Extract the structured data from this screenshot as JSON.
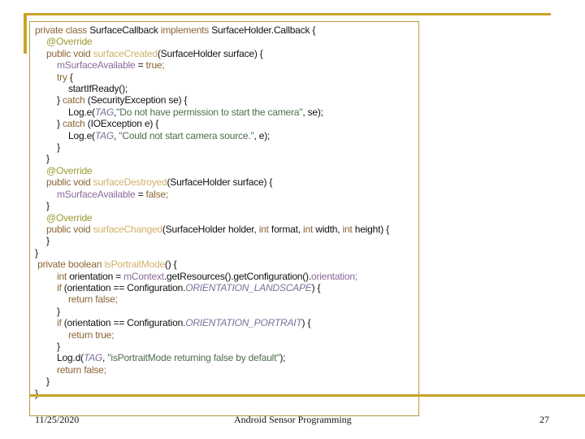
{
  "code_lines": [
    {
      "indent": 0,
      "segs": [
        [
          "private class ",
          "kw"
        ],
        [
          "SurfaceCallback ",
          "plain"
        ],
        [
          "implements ",
          "kw"
        ],
        [
          "SurfaceHolder.Callback {",
          "plain"
        ]
      ]
    },
    {
      "indent": 1,
      "segs": [
        [
          "@Override",
          "ann"
        ]
      ]
    },
    {
      "indent": 1,
      "segs": [
        [
          "public void ",
          "kw"
        ],
        [
          "surfaceCreated",
          "mth"
        ],
        [
          "(SurfaceHolder surface) {",
          "plain"
        ]
      ]
    },
    {
      "indent": 2,
      "segs": [
        [
          "mSurfaceAvailable",
          "fld"
        ],
        [
          " = ",
          "plain"
        ],
        [
          "true;",
          "kw"
        ]
      ]
    },
    {
      "indent": 2,
      "segs": [
        [
          "try",
          "kw"
        ],
        [
          " {",
          "plain"
        ]
      ]
    },
    {
      "indent": 3,
      "segs": [
        [
          "startIfReady();",
          "plain"
        ]
      ]
    },
    {
      "indent": 2,
      "segs": [
        [
          "} ",
          "plain"
        ],
        [
          "catch",
          "kw"
        ],
        [
          " (SecurityException se) {",
          "plain"
        ]
      ]
    },
    {
      "indent": 3,
      "segs": [
        [
          "Log.",
          "plain"
        ],
        [
          "e",
          "plain"
        ],
        [
          "(",
          "plain"
        ],
        [
          "TAG",
          "cst"
        ],
        [
          ",",
          "plain"
        ],
        [
          "\"Do not have permission to start the camera\"",
          "str"
        ],
        [
          ", se);",
          "plain"
        ]
      ]
    },
    {
      "indent": 2,
      "segs": [
        [
          "} ",
          "plain"
        ],
        [
          "catch",
          "kw"
        ],
        [
          " (IOException e) {",
          "plain"
        ]
      ]
    },
    {
      "indent": 3,
      "segs": [
        [
          "Log.",
          "plain"
        ],
        [
          "e",
          "plain"
        ],
        [
          "(",
          "plain"
        ],
        [
          "TAG",
          "cst"
        ],
        [
          ", ",
          "plain"
        ],
        [
          "\"Could not start camera source.\"",
          "str"
        ],
        [
          ", e);",
          "plain"
        ]
      ]
    },
    {
      "indent": 2,
      "segs": [
        [
          "}",
          "plain"
        ]
      ]
    },
    {
      "indent": 1,
      "segs": [
        [
          "}",
          "plain"
        ]
      ]
    },
    {
      "indent": 1,
      "segs": [
        [
          "@Override",
          "ann"
        ]
      ]
    },
    {
      "indent": 1,
      "segs": [
        [
          "public void ",
          "kw"
        ],
        [
          "surfaceDestroyed",
          "mth"
        ],
        [
          "(SurfaceHolder surface) {",
          "plain"
        ]
      ]
    },
    {
      "indent": 2,
      "segs": [
        [
          "mSurfaceAvailable",
          "fld"
        ],
        [
          " = ",
          "plain"
        ],
        [
          "false;",
          "kw"
        ]
      ]
    },
    {
      "indent": 1,
      "segs": [
        [
          "}",
          "plain"
        ]
      ]
    },
    {
      "indent": 1,
      "segs": [
        [
          "@Override",
          "ann"
        ]
      ]
    },
    {
      "indent": 1,
      "segs": [
        [
          "public void ",
          "kw"
        ],
        [
          "surfaceChanged",
          "mth"
        ],
        [
          "(SurfaceHolder holder, ",
          "plain"
        ],
        [
          "int",
          "kw"
        ],
        [
          " format, ",
          "plain"
        ],
        [
          "int",
          "kw"
        ],
        [
          " width, ",
          "plain"
        ],
        [
          "int",
          "kw"
        ],
        [
          " height) {",
          "plain"
        ]
      ]
    },
    {
      "indent": 1,
      "segs": [
        [
          "}",
          "plain"
        ]
      ]
    },
    {
      "indent": 0,
      "segs": [
        [
          "}",
          "plain"
        ]
      ]
    },
    {
      "indent": 0,
      "segs": [
        [
          " private boolean ",
          "kw"
        ],
        [
          "isPortraitMode",
          "mth"
        ],
        [
          "() {",
          "plain"
        ]
      ]
    },
    {
      "indent": 2,
      "segs": [
        [
          "int",
          "kw"
        ],
        [
          " orientation = ",
          "plain"
        ],
        [
          "mContext",
          "fld"
        ],
        [
          ".getResources().getConfiguration().",
          "plain"
        ],
        [
          "orientation;",
          "fld"
        ]
      ]
    },
    {
      "indent": 2,
      "segs": [
        [
          "if",
          "kw"
        ],
        [
          " (orientation == Configuration.",
          "plain"
        ],
        [
          "ORIENTATION_LANDSCAPE",
          "cst"
        ],
        [
          ") {",
          "plain"
        ]
      ]
    },
    {
      "indent": 3,
      "segs": [
        [
          "return false;",
          "kw"
        ]
      ]
    },
    {
      "indent": 2,
      "segs": [
        [
          "}",
          "plain"
        ]
      ]
    },
    {
      "indent": 2,
      "segs": [
        [
          "if",
          "kw"
        ],
        [
          " (orientation == Configuration.",
          "plain"
        ],
        [
          "ORIENTATION_PORTRAIT",
          "cst"
        ],
        [
          ") {",
          "plain"
        ]
      ]
    },
    {
      "indent": 3,
      "segs": [
        [
          "return true;",
          "kw"
        ]
      ]
    },
    {
      "indent": 2,
      "segs": [
        [
          "}",
          "plain"
        ]
      ]
    },
    {
      "indent": 2,
      "segs": [
        [
          "Log.",
          "plain"
        ],
        [
          "d",
          "plain"
        ],
        [
          "(",
          "plain"
        ],
        [
          "TAG",
          "cst"
        ],
        [
          ", ",
          "plain"
        ],
        [
          "\"isPortraitMode returning false by default\"",
          "str"
        ],
        [
          ");",
          "plain"
        ]
      ]
    },
    {
      "indent": 2,
      "segs": [
        [
          "return false;",
          "kw"
        ]
      ]
    },
    {
      "indent": 1,
      "segs": [
        [
          "}",
          "plain"
        ]
      ]
    },
    {
      "indent": 0,
      "segs": [
        [
          "}",
          "plain"
        ]
      ]
    }
  ],
  "footer": {
    "date": "11/25/2020",
    "title": "Android Sensor Programming",
    "page": "27"
  },
  "colors": {
    "accent": "#c9a227",
    "keyword": "#8c6434",
    "method": "#d2b06a",
    "field": "#8a6a9a",
    "string": "#4e6e4e",
    "constant": "#7c6f9a",
    "annotation": "#9a9a30"
  }
}
